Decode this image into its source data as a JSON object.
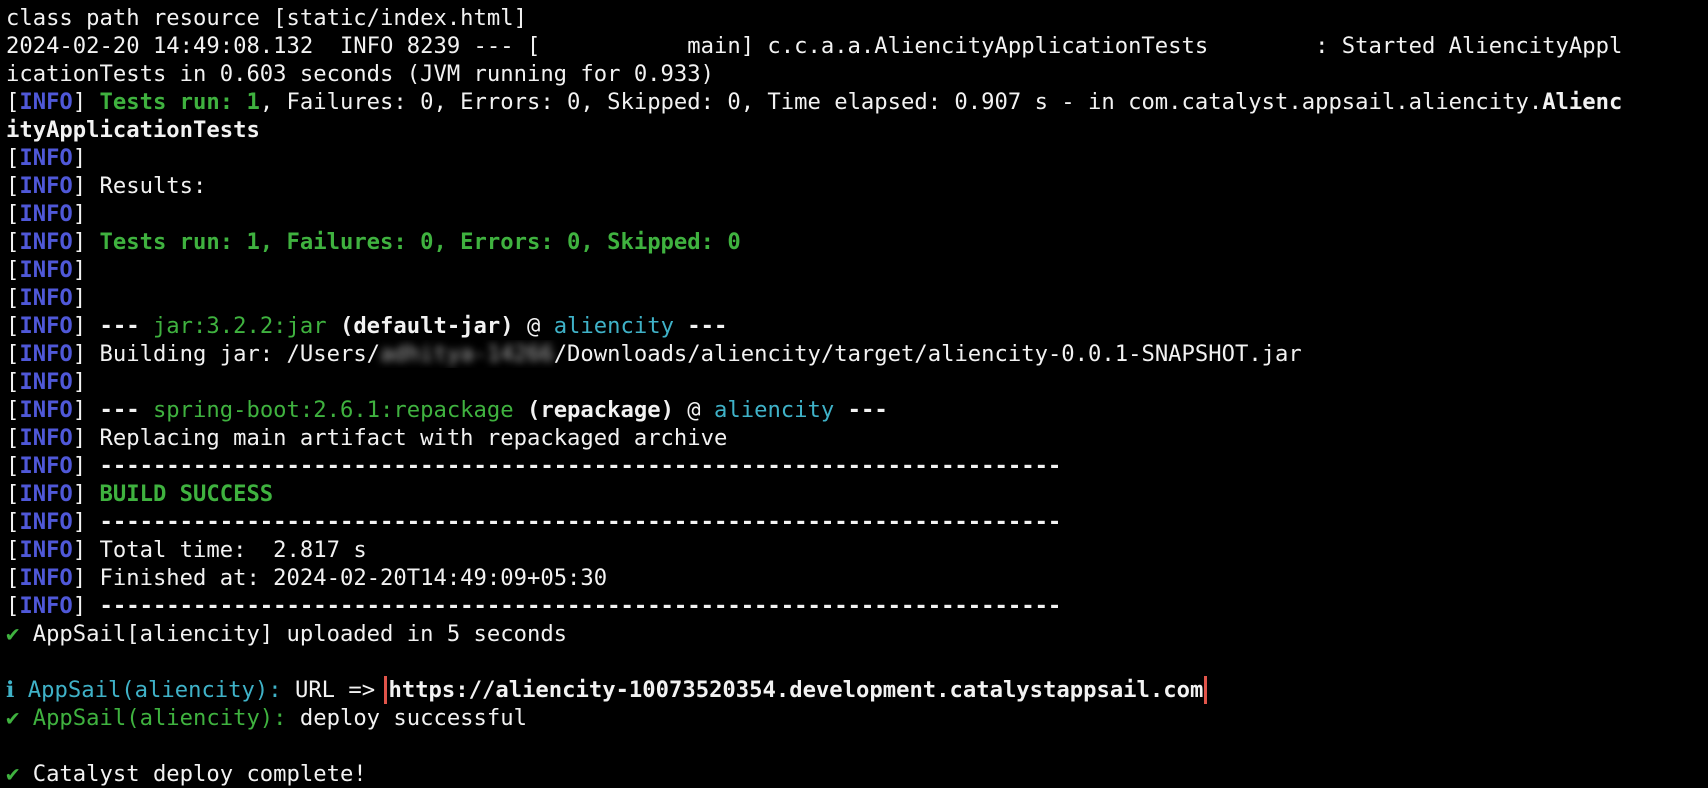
{
  "terminal": {
    "line1": "class path resource [static/index.html]",
    "line2": "2024-02-20 14:49:08.132  INFO 8239 --- [           main] c.c.a.a.AliencityApplicationTests        : Started AliencityAppl",
    "line3": "icationTests in 0.603 seconds (JVM running for 0.933)",
    "info_tag": "INFO",
    "tests_run_prefix": "Tests run: 1",
    "tests_run_rest": ", Failures: 0, Errors: 0, Skipped: 0, Time elapsed: 0.907 s - in com.catalyst.appsail.aliencity.",
    "tests_run_class_a": "Alienc",
    "tests_run_class_b": "ityApplicationTests",
    "results_label": "Results:",
    "tests_summary": "Tests run: 1, Failures: 0, Errors: 0, Skipped: 0",
    "jar_plugin": "jar:3.2.2:jar",
    "jar_goal": "(default-jar)",
    "project": "aliencity",
    "dashes_short": "---",
    "at_sign": "@",
    "building_jar_prefix": "Building jar: /Users/",
    "redacted_user": "adhitya-14266",
    "building_jar_suffix": "/Downloads/aliencity/target/aliencity-0.0.1-SNAPSHOT.jar",
    "repackage_plugin": "spring-boot:2.6.1:repackage",
    "repackage_goal": "(repackage)",
    "replacing": "Replacing main artifact with repackaged archive",
    "separator": "------------------------------------------------------------------------",
    "build_success": "BUILD SUCCESS",
    "total_time": "Total time:  2.817 s",
    "finished_at": "Finished at: 2024-02-20T14:49:09+05:30",
    "check_glyph": "✔",
    "info_glyph": "ℹ",
    "uploaded": "AppSail[aliencity] uploaded in 5 seconds",
    "appsail_label": "AppSail(aliencity):",
    "url_label": "URL =>",
    "url": "https://aliencity-10073520354.development.catalystappsail.com",
    "deploy_successful": "deploy successful",
    "deploy_complete": "Catalyst deploy complete!"
  },
  "colors": {
    "background": "#000000",
    "text": "#f2f2f2",
    "info_tag": "#4f58d8",
    "success_green": "#3fb23f",
    "cyan": "#3fb2c8",
    "highlight_box": "#e0544a"
  },
  "icons": {
    "check": "check-icon",
    "info": "info-icon"
  }
}
